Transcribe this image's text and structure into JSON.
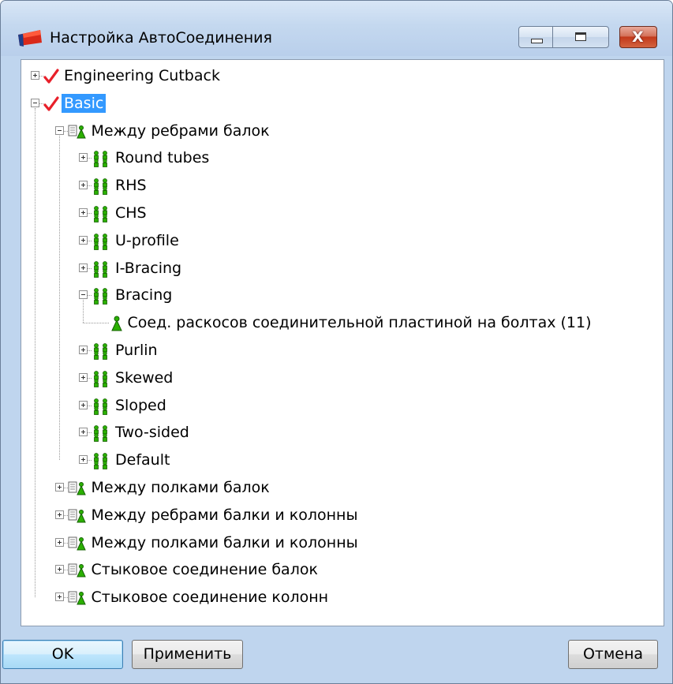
{
  "window": {
    "title": "Настройка АвтоСоединения",
    "close_glyph": "X"
  },
  "tree": [
    {
      "label": "Engineering Cutback",
      "level": 0,
      "expander": "plus",
      "icon": "red-check-icon",
      "selected": false
    },
    {
      "label": "Basic",
      "level": 0,
      "expander": "minus",
      "icon": "red-check-icon",
      "selected": true
    },
    {
      "label": "Между ребрами балок",
      "level": 1,
      "expander": "minus",
      "icon": "rule-group-icon",
      "selected": false
    },
    {
      "label": "Round tubes",
      "level": 2,
      "expander": "plus",
      "icon": "green-figures-icon",
      "selected": false
    },
    {
      "label": "RHS",
      "level": 2,
      "expander": "plus",
      "icon": "green-figures-icon",
      "selected": false
    },
    {
      "label": "CHS",
      "level": 2,
      "expander": "plus",
      "icon": "green-figures-icon",
      "selected": false
    },
    {
      "label": "U-profile",
      "level": 2,
      "expander": "plus",
      "icon": "green-figures-icon",
      "selected": false
    },
    {
      "label": "I-Bracing",
      "level": 2,
      "expander": "plus",
      "icon": "green-figures-icon",
      "selected": false
    },
    {
      "label": "Bracing",
      "level": 2,
      "expander": "minus",
      "icon": "green-figures-icon",
      "selected": false
    },
    {
      "label": "Соед. раскосов соединительной пластиной на болтах (11)",
      "level": 3,
      "expander": "none",
      "icon": "green-figure-icon",
      "selected": false
    },
    {
      "label": "Purlin",
      "level": 2,
      "expander": "plus",
      "icon": "green-figures-icon",
      "selected": false
    },
    {
      "label": "Skewed",
      "level": 2,
      "expander": "plus",
      "icon": "green-figures-icon",
      "selected": false
    },
    {
      "label": "Sloped",
      "level": 2,
      "expander": "plus",
      "icon": "green-figures-icon",
      "selected": false
    },
    {
      "label": "Two-sided",
      "level": 2,
      "expander": "plus",
      "icon": "green-figures-icon",
      "selected": false
    },
    {
      "label": "Default",
      "level": 2,
      "expander": "plus",
      "icon": "green-figures-icon",
      "selected": false
    },
    {
      "label": "Между полками балок",
      "level": 1,
      "expander": "plus",
      "icon": "rule-group-icon",
      "selected": false
    },
    {
      "label": "Между ребрами балки и колонны",
      "level": 1,
      "expander": "plus",
      "icon": "rule-group-icon",
      "selected": false
    },
    {
      "label": "Между полками балки и колонны",
      "level": 1,
      "expander": "plus",
      "icon": "rule-group-icon",
      "selected": false
    },
    {
      "label": "Стыковое соединение балок",
      "level": 1,
      "expander": "plus",
      "icon": "rule-group-icon",
      "selected": false
    },
    {
      "label": "Стыковое соединение колонн",
      "level": 1,
      "expander": "plus",
      "icon": "rule-group-icon",
      "selected": false
    }
  ],
  "buttons": {
    "ok": "OK",
    "apply": "Применить",
    "cancel": "Отмена"
  },
  "colors": {
    "selection": "#3399ff",
    "check": "#e8202a",
    "figure_green": "#2bb000"
  }
}
